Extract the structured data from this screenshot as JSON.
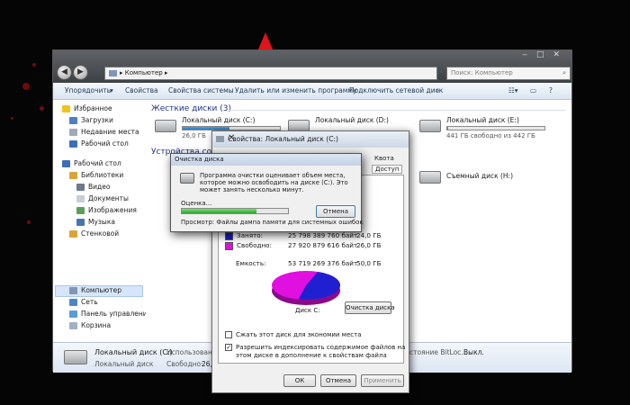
{
  "explorer": {
    "address": "Компьютер",
    "search_placeholder": "Поиск: Компьютер",
    "toolbar": [
      "Упорядочить",
      "Свойства",
      "Свойства системы",
      "Удалить или изменить программу",
      "Подключить сетевой диск",
      "»"
    ],
    "sidebar": {
      "favorites": {
        "label": "Избранное",
        "items": [
          "Загрузки",
          "Недавние места",
          "Рабочий стол"
        ]
      },
      "desktop": "Рабочий стол",
      "libraries": {
        "label": "Библиотеки",
        "items": [
          "Видео",
          "Документы",
          "Изображения",
          "Музыка"
        ]
      },
      "others": [
        "Стенковой",
        "Компьютер",
        "Сеть",
        "Панель управления",
        "Корзина"
      ]
    },
    "hdd_group": "Жесткие диски (3)",
    "devices_group": "Устройства со",
    "drives": [
      {
        "name": "Локальный диск (C:)",
        "free": "26,0 ГБ",
        "used_fraction": 0.48
      },
      {
        "name": "Локальный диск (D:)",
        "free": "",
        "used_fraction": 0
      },
      {
        "name": "Локальный диск (E:)",
        "free": "441 ГБ свободно из 442 ГБ",
        "used_fraction": 0.01
      }
    ],
    "removable": "Съемный диск (H:)",
    "details": {
      "name": "Локальный диск (C:)",
      "type": "Локальный диск",
      "used_label": "Использовано:",
      "free_label": "Свободно:",
      "free_value": "26,0 ГБ",
      "bitlocker": "стояние BitLoc...",
      "bitlocker_value": "Выкл."
    }
  },
  "props": {
    "title": "Свойства: Локальный диск (C:)",
    "tabs": [
      "Квота",
      "Доступ"
    ],
    "used": {
      "label": "Занято:",
      "bytes": "25 798 389 760 байт",
      "gb": "24,0 ГБ",
      "color": "#1a1acc"
    },
    "free": {
      "label": "Свободно:",
      "bytes": "27 920 879 616 байт",
      "gb": "26,0 ГБ",
      "color": "#e010e0"
    },
    "capacity": {
      "label": "Емкость:",
      "bytes": "53 719 269 376 байт",
      "gb": "50,0 ГБ"
    },
    "disk_label": "Диск C:",
    "cleanup_button": "Очистка диска",
    "compress": "Сжать этот диск для экономии места",
    "index": "Разрешить индексировать содержимое файлов на этом диске в дополнение к свойствам файла",
    "buttons": {
      "ok": "ОК",
      "cancel": "Отмена",
      "apply": "Применить"
    }
  },
  "cleanup": {
    "title": "Очистка диска",
    "message": "Программа очистки оценивает объем места, которое можно освободить на диске (C:). Это может занять несколько минут.",
    "estimate": "Оценка...",
    "cancel": "Отмена",
    "scanning": "Просмотр:",
    "scanning_item": "Файлы дампа памяти для системных ошибок",
    "progress": 0.7
  }
}
